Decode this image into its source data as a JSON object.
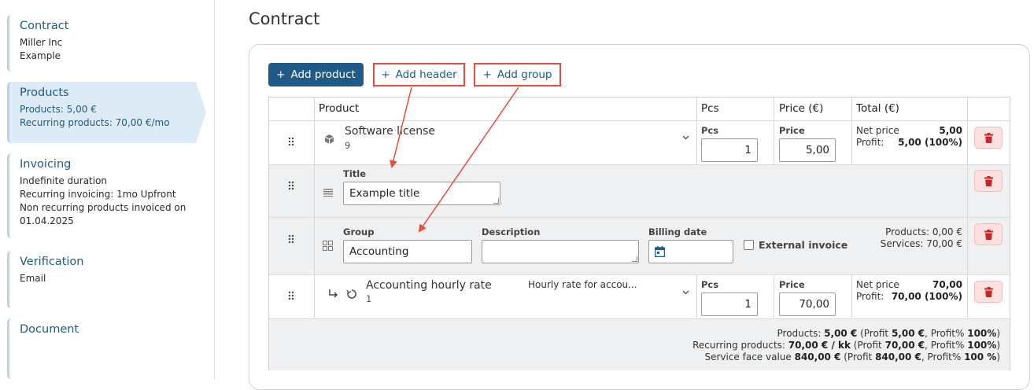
{
  "sidebar": {
    "steps": [
      {
        "title": "Contract",
        "lines": [
          "Miller Inc",
          "Example"
        ]
      },
      {
        "title": "Products",
        "lines": [
          "Products: 5,00 €",
          "Recurring products: 70,00 €/mo"
        ]
      },
      {
        "title": "Invoicing",
        "lines": [
          "Indefinite duration",
          "Recurring invoicing: 1mo Upfront",
          "Non recurring products invoiced on",
          "01.04.2025"
        ]
      },
      {
        "title": "Verification",
        "lines": [
          "Email"
        ]
      },
      {
        "title": "Document",
        "lines": []
      }
    ]
  },
  "main": {
    "title": "Contract",
    "buttons": {
      "add_product": "Add product",
      "add_header": "Add header",
      "add_group": "Add group",
      "plus": "+"
    },
    "columns": {
      "product": "Product",
      "pcs": "Pcs",
      "price": "Price (€)",
      "total": "Total (€)"
    },
    "labels": {
      "pcs": "Pcs",
      "price": "Price",
      "title": "Title",
      "group": "Group",
      "description": "Description",
      "billing_date": "Billing date",
      "external_invoice": "External invoice",
      "net_price": "Net price",
      "profit": "Profit:"
    },
    "row1": {
      "name": "Software license",
      "sku": "9",
      "pcs": "1",
      "price": "5,00",
      "net_price": "5,00",
      "profit": "5,00 (100%)"
    },
    "row2": {
      "title_value": "Example title"
    },
    "row3": {
      "group_value": "Accounting",
      "description_value": "",
      "billing_date_value": "",
      "external_invoice_checked": false,
      "products_total": "Products: 0,00 €",
      "services_total": "Services: 70,00 €"
    },
    "row4": {
      "name": "Accounting hourly rate",
      "sku": "1",
      "description": "Hourly rate for accou...",
      "pcs": "1",
      "price": "70,00",
      "net_price": "70,00",
      "profit": "70,00 (100%)"
    },
    "summary": {
      "line1": {
        "prefix": "Products: ",
        "value": "5,00 €",
        "mid": " (Profit ",
        "profit": "5,00 €",
        "mid2": ", Profit% ",
        "pct": "100%",
        "suffix": ")"
      },
      "line2": {
        "prefix": "Recurring products: ",
        "value": "70,00 € / kk",
        "mid": " (Profit ",
        "profit": "70,00 €",
        "mid2": ", Profit% ",
        "pct": "100%",
        "suffix": ")"
      },
      "line3": {
        "prefix": "Service face value ",
        "value": "840,00 €",
        "mid": " (Profit ",
        "profit": "840,00 €",
        "mid2": ", Profit% ",
        "pct": "100 %",
        "suffix": ")"
      }
    }
  },
  "colors": {
    "primary": "#1f5b86",
    "annotation_red": "#e74c3c",
    "delete_bg": "#fde1e1",
    "delete_icon": "#c62828",
    "row_gray": "#eef0f2"
  },
  "icons": [
    "drag-handle-icon",
    "box-icon",
    "lines-icon",
    "grid-icon",
    "sub-arrow-icon",
    "recurring-icon",
    "calendar-icon",
    "trash-icon",
    "chevron-down-icon",
    "plus-icon"
  ]
}
